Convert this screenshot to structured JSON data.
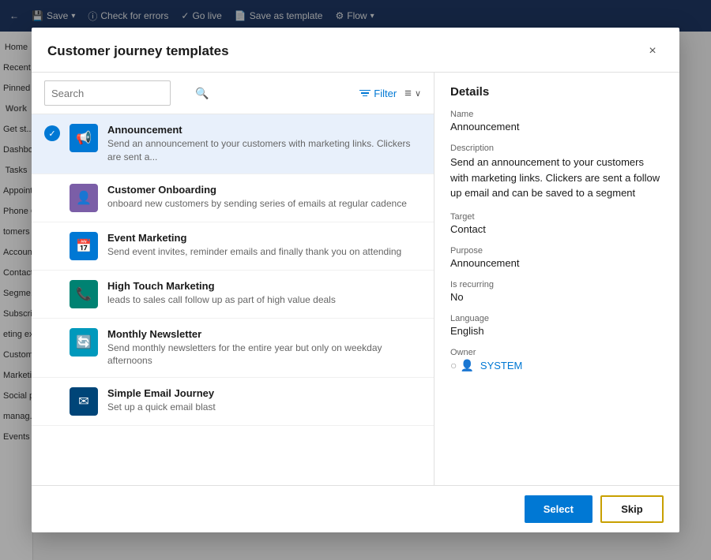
{
  "dialog": {
    "title": "Customer journey templates",
    "close_label": "×"
  },
  "search": {
    "placeholder": "Search",
    "value": ""
  },
  "filter": {
    "label": "Filter",
    "sort_icon1": "≡",
    "sort_icon2": "∨"
  },
  "templates": [
    {
      "id": "announcement",
      "name": "Announcement",
      "desc": "Send an announcement to your customers with marketing links. Clickers are sent a...",
      "icon": "📢",
      "iconClass": "icon-blue",
      "selected": true
    },
    {
      "id": "customer-onboarding",
      "name": "Customer Onboarding",
      "desc": "onboard new customers by sending series of emails at regular cadence",
      "icon": "👤",
      "iconClass": "icon-purple",
      "selected": false
    },
    {
      "id": "event-marketing",
      "name": "Event Marketing",
      "desc": "Send event invites, reminder emails and finally thank you on attending",
      "icon": "📅",
      "iconClass": "icon-blue",
      "selected": false
    },
    {
      "id": "high-touch-marketing",
      "name": "High Touch Marketing",
      "desc": "leads to sales call follow up as part of high value deals",
      "icon": "📞",
      "iconClass": "icon-teal",
      "selected": false
    },
    {
      "id": "monthly-newsletter",
      "name": "Monthly Newsletter",
      "desc": "Send monthly newsletters for the entire year but only on weekday afternoons",
      "icon": "🔄",
      "iconClass": "icon-cyan",
      "selected": false
    },
    {
      "id": "simple-email-journey",
      "name": "Simple Email Journey",
      "desc": "Set up a quick email blast",
      "icon": "✉",
      "iconClass": "icon-dark-blue",
      "selected": false
    }
  ],
  "details": {
    "section_title": "Details",
    "fields": {
      "name_label": "Name",
      "name_value": "Announcement",
      "description_label": "Description",
      "description_value": "Send an announcement to your customers with marketing links. Clickers are sent a follow up email and can be saved to a segment",
      "target_label": "Target",
      "target_value": "Contact",
      "purpose_label": "Purpose",
      "purpose_value": "Announcement",
      "recurring_label": "Is recurring",
      "recurring_value": "No",
      "language_label": "Language",
      "language_value": "English",
      "owner_label": "Owner",
      "owner_value": "SYSTEM"
    }
  },
  "footer": {
    "select_label": "Select",
    "skip_label": "Skip"
  },
  "topbar": {
    "back_label": "←",
    "save_label": "Save",
    "check_errors_label": "Check for errors",
    "go_live_label": "Go live",
    "save_template_label": "Save as template",
    "flow_label": "Flow"
  },
  "sidebar": {
    "items": [
      "Home",
      "Recent",
      "Pinned",
      "Work",
      "Get st...",
      "Dashbo...",
      "Tasks",
      "Appoint",
      "Phone C...",
      "tomers",
      "Account",
      "Contact",
      "Segme...",
      "Subscri...",
      "eting ex...",
      "Custom...",
      "Marketi...",
      "Social p...",
      "manag...",
      "Events"
    ]
  }
}
